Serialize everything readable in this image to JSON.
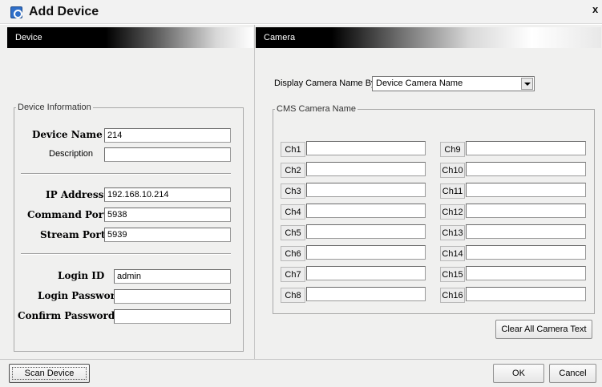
{
  "window": {
    "title": "Add Device",
    "close_label": "x",
    "app_icon": "camera-device-icon"
  },
  "device": {
    "header": "Device",
    "group_title": "Device Information",
    "device_name_label": "Device Name",
    "device_name_value": "214",
    "description_label": "Description",
    "description_value": "",
    "ip_address_label": "IP Address",
    "ip_address_value": "192.168.10.214",
    "command_port_label": "Command Port",
    "command_port_value": "5938",
    "stream_port_label": "Stream Port",
    "stream_port_value": "5939",
    "login_id_label": "Login ID",
    "login_id_value": "admin",
    "login_password_label": "Login Password",
    "login_password_value": "",
    "confirm_password_label": "Confirm Password",
    "confirm_password_value": ""
  },
  "camera": {
    "header": "Camera",
    "display_by_label": "Display Camera Name By",
    "display_by_value": "Device Camera Name",
    "group_title": "CMS Camera Name",
    "channels": [
      {
        "label": "Ch1",
        "value": ""
      },
      {
        "label": "Ch2",
        "value": ""
      },
      {
        "label": "Ch3",
        "value": ""
      },
      {
        "label": "Ch4",
        "value": ""
      },
      {
        "label": "Ch5",
        "value": ""
      },
      {
        "label": "Ch6",
        "value": ""
      },
      {
        "label": "Ch7",
        "value": ""
      },
      {
        "label": "Ch8",
        "value": ""
      },
      {
        "label": "Ch9",
        "value": ""
      },
      {
        "label": "Ch10",
        "value": ""
      },
      {
        "label": "Ch11",
        "value": ""
      },
      {
        "label": "Ch12",
        "value": ""
      },
      {
        "label": "Ch13",
        "value": ""
      },
      {
        "label": "Ch14",
        "value": ""
      },
      {
        "label": "Ch15",
        "value": ""
      },
      {
        "label": "Ch16",
        "value": ""
      }
    ],
    "clear_button": "Clear All Camera Text"
  },
  "footer": {
    "scan_button": "Scan Device",
    "ok_button": "OK",
    "cancel_button": "Cancel"
  }
}
